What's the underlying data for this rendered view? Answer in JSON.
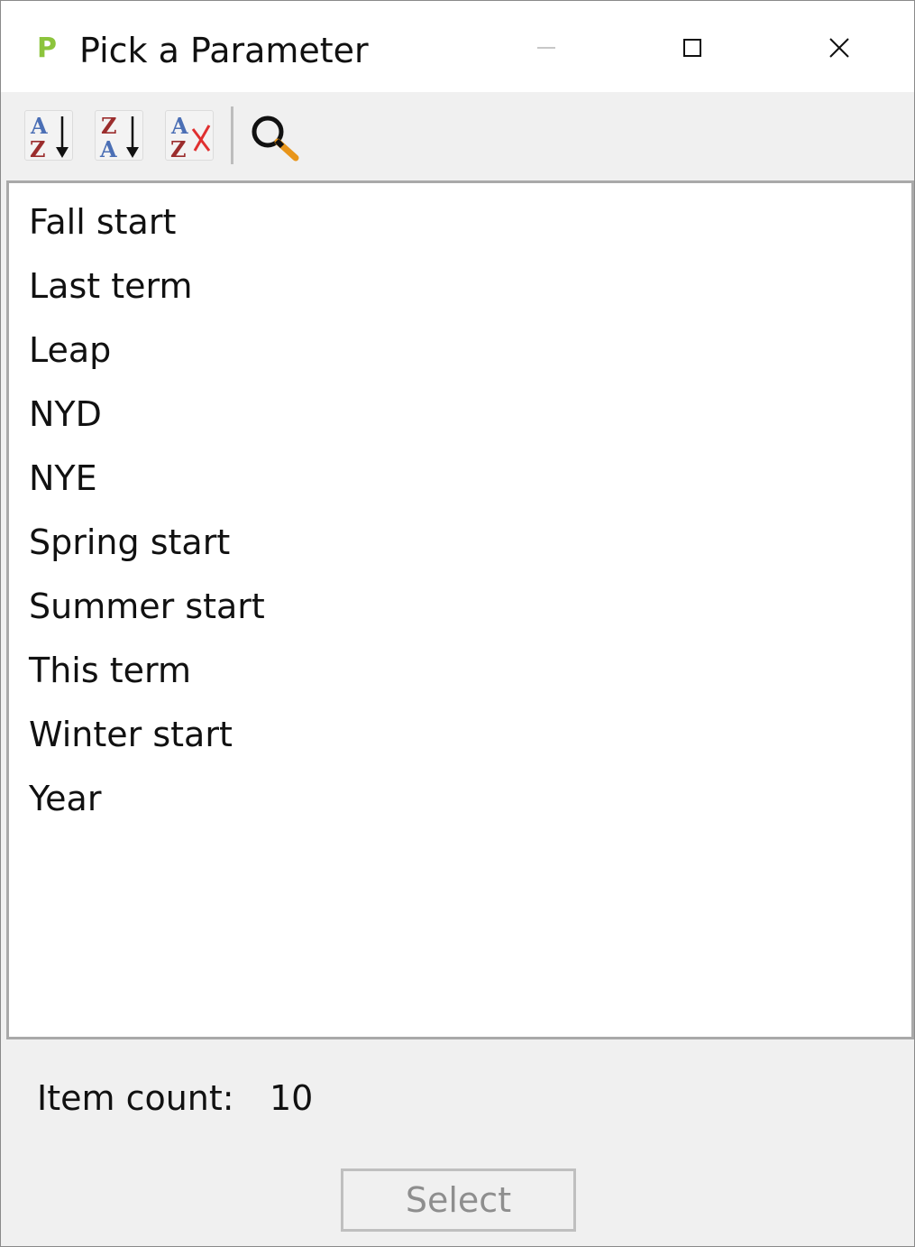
{
  "window": {
    "title": "Pick a Parameter",
    "icon": "p-letter-icon",
    "controls": [
      "minimize-icon",
      "maximize-icon",
      "close-icon"
    ]
  },
  "toolbar": {
    "buttons": [
      {
        "icon": "sort-ascending-icon"
      },
      {
        "icon": "sort-descending-icon"
      },
      {
        "icon": "clear-sort-icon"
      },
      {
        "icon": "search-icon"
      }
    ]
  },
  "list": {
    "items": [
      "Fall start",
      "Last term",
      "Leap",
      "NYD",
      "NYE",
      "Spring start",
      "Summer start",
      "This term",
      "Winter start",
      "Year"
    ]
  },
  "footer": {
    "item_count_label": "Item count:",
    "item_count_value": "10",
    "select_label": "Select"
  },
  "colors": {
    "app_icon_green": "#8cc43c",
    "sort_letter_blue": "#4b6fb5",
    "sort_letter_red": "#9b2d2d",
    "clear_x_red": "#e03030",
    "search_handle_orange": "#e8951a"
  }
}
